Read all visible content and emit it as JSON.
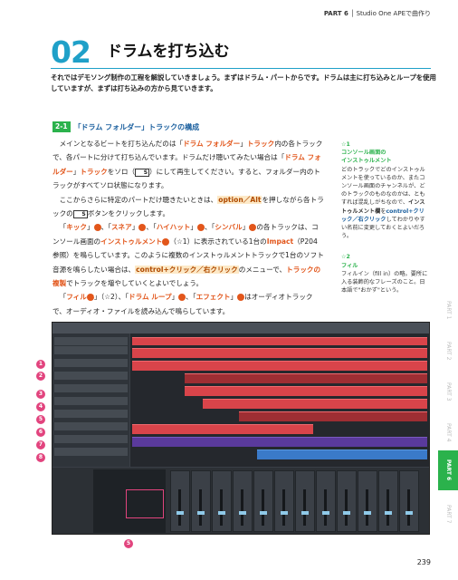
{
  "header": {
    "part": "PART 6",
    "title": "Studio One APEで曲作り"
  },
  "chapter": {
    "number": "02",
    "title": "ドラムを打ち込む"
  },
  "intro": "それではデモソング制作の工程を解説していきましょう。まずはドラム・パートからです。ドラムは主に打ち込みとループを使用していますが、まずは打ち込みの方から見ていきます。",
  "section": {
    "tag": "2-1",
    "title": "「ドラム フォルダー」トラックの構成"
  },
  "body": {
    "p1_a": "メインとなるビートを打ち込んだのは「",
    "p1_b": "ドラム フォルダー",
    "p1_c": "」",
    "p1_d": "トラック",
    "p1_e": "内の各トラックで、各パートに分けて打ち込んでいます。ドラムだけ聴いてみたい場合は「",
    "p1_f": "ドラム フォルダー",
    "p1_g": "」",
    "p1_h": "トラック",
    "p1_i": "をソロ（",
    "p1_j": "S",
    "p1_k": "）にして再生してください。すると、フォルダー内のトラックがすべてソロ状態になります。",
    "p2_a": "ここからさらに特定のパートだけ聴きたいときは、",
    "p2_b": "option／Alt",
    "p2_c": "を押しながら各トラックの",
    "p2_d": "S",
    "p2_e": "ボタンをクリックします。",
    "p3_a": "「",
    "p3_kick": "キック",
    "p3_b": "」",
    "p3_c": "、「",
    "p3_snare": "スネア",
    "p3_d": "」",
    "p3_e": "、「",
    "p3_hihat": "ハイハット",
    "p3_f": "」",
    "p3_g": "、「",
    "p3_cymbal": "シンバル",
    "p3_h": "」",
    "p3_i": "の各トラックは、コンソール画面の",
    "p3_j": "インストゥルメント",
    "p3_k": "（☆1）に表示されている1台の",
    "p3_l": "Impact",
    "p3_m": "（P204参照）を鳴らしています。このように複数のインストゥルメントトラックで1台のソフト音源を鳴らしたい場合は、",
    "p3_n": "control+クリック／右クリック",
    "p3_o": "のメニューで、",
    "p3_p": "トラックの複製",
    "p3_q": "でトラックを増やしていくとよいでしょう。",
    "p4_a": "「",
    "p4_fill": "フィル",
    "p4_b": "」（☆2）、「",
    "p4_loop": "ドラム ループ",
    "p4_c": "」",
    "p4_d": "、「",
    "p4_fx": "エフェクト",
    "p4_e": "」",
    "p4_f": "はオーディオトラックで、オーディオ・ファイルを読み込んで鳴らしています。",
    "n1": "1",
    "n2": "2",
    "n3": "3",
    "n4": "4",
    "n5": "5",
    "n6": "6",
    "n7": "7",
    "n8": "8"
  },
  "sidebar": {
    "note1_mark": "☆1",
    "note1_head": "コンソール画面の",
    "note1_head2": "インストゥルメント",
    "note1_text_a": "どのトラックでどのインストゥルメントを使っているのか、またコンソール画面のチャンネルが、どのトラックのものなのかは、ともすれば混乱しがちなので、",
    "note1_text_b": "インストゥルメント欄",
    "note1_text_c": "を",
    "note1_text_d": "control+クリック／右クリック",
    "note1_text_e": "してわかりやすい名前に変更しておくとよいだろう。",
    "note2_mark": "☆2",
    "note2_head": "フィル",
    "note2_text": "フィルイン（fill in）の略。要所に入る装飾的なフレーズのこと。日本語で\"おかず\"という。"
  },
  "tabs": {
    "active": "PART 6",
    "others": [
      "PART 1",
      "PART 2",
      "PART 3",
      "PART 4",
      "PART 5",
      "PART 7"
    ]
  },
  "callouts": [
    "1",
    "2",
    "3",
    "4",
    "5",
    "6",
    "7",
    "8",
    "5"
  ],
  "page_number": "239"
}
